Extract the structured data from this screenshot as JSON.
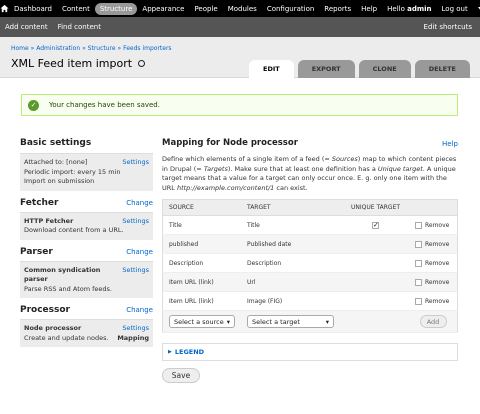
{
  "toolbar": {
    "items": [
      "Dashboard",
      "Content",
      "Structure",
      "Appearance",
      "People",
      "Modules",
      "Configuration",
      "Reports",
      "Help"
    ],
    "hello": "Hello",
    "user": "admin",
    "logout": "Log out"
  },
  "shortcuts": {
    "add_content": "Add content",
    "find_content": "Find content",
    "edit_shortcuts": "Edit shortcuts"
  },
  "breadcrumb": [
    "Home",
    "Administration",
    "Structure",
    "Feeds importers"
  ],
  "breadcrumb_sep": "»",
  "page_title": "XML Feed item import",
  "tabs": [
    "EDIT",
    "EXPORT",
    "CLONE",
    "DELETE"
  ],
  "message": "Your changes have been saved.",
  "sidebar": {
    "basic": {
      "heading": "Basic settings",
      "attached": "Attached to: [none]",
      "settings": "Settings",
      "periodic": "Periodic import: every 15 min",
      "import": "Import on submission"
    },
    "fetcher": {
      "heading": "Fetcher",
      "change": "Change",
      "name": "HTTP Fetcher",
      "settings": "Settings",
      "desc": "Download content from a URL."
    },
    "parser": {
      "heading": "Parser",
      "change": "Change",
      "name": "Common syndication parser",
      "settings": "Settings",
      "desc": "Parse RSS and Atom feeds."
    },
    "processor": {
      "heading": "Processor",
      "change": "Change",
      "name": "Node processor",
      "settings": "Settings",
      "desc": "Create and update nodes.",
      "mapping": "Mapping"
    }
  },
  "main": {
    "heading": "Mapping for Node processor",
    "help": "Help",
    "desc_1": "Define which elements of a single item of a feed (= ",
    "desc_sources": "Sources",
    "desc_2": ") map to which content pieces in Drupal (= ",
    "desc_targets": "Targets",
    "desc_3": "). Make sure that at least one definition has a ",
    "desc_unique": "Unique target",
    "desc_4": ". A unique target means that a value for a target can only occur once. E. g. only one item with the URL ",
    "desc_url": "http://example.com/content/1",
    "desc_5": " can exist.",
    "columns": [
      "SOURCE",
      "TARGET",
      "UNIQUE TARGET",
      ""
    ],
    "rows": [
      {
        "source": "Title",
        "target": "Title",
        "unique": true,
        "remove": "Remove"
      },
      {
        "source": "published",
        "target": "Published date",
        "unique": false,
        "remove": "Remove"
      },
      {
        "source": "Description",
        "target": "Description",
        "unique": false,
        "remove": "Remove"
      },
      {
        "source": "Item URL (link)",
        "target": "Url",
        "unique": false,
        "remove": "Remove"
      },
      {
        "source": "Item URL (link)",
        "target": "Image (FIG)",
        "unique": false,
        "remove": "Remove"
      }
    ],
    "select_source": "Select a source",
    "select_target": "Select a target",
    "add": "Add",
    "legend": "LEGEND",
    "save": "Save"
  }
}
